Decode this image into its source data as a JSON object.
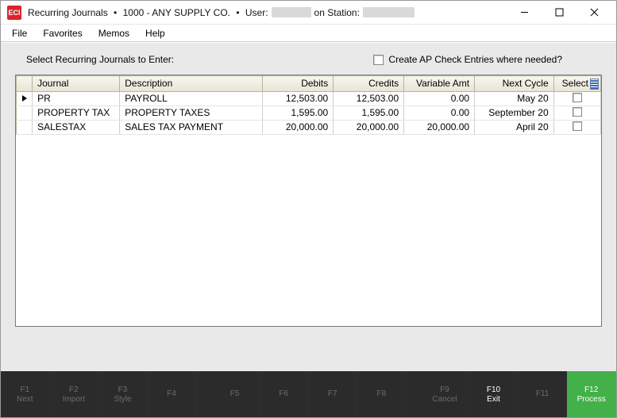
{
  "title": {
    "app_icon_text": "ECI",
    "window_name": "Recurring Journals",
    "company": "1000 - ANY SUPPLY CO.",
    "user_label": "User:",
    "station_label": "on Station:"
  },
  "menu": {
    "file": "File",
    "favorites": "Favorites",
    "memos": "Memos",
    "help": "Help"
  },
  "prompt": "Select Recurring Journals to Enter:",
  "ap_checkbox_label": "Create AP Check Entries where needed?",
  "columns": {
    "journal": "Journal",
    "description": "Description",
    "debits": "Debits",
    "credits": "Credits",
    "variable_amt": "Variable Amt",
    "next_cycle": "Next Cycle",
    "select": "Select"
  },
  "rows": [
    {
      "journal": "PR",
      "description": "PAYROLL",
      "debits": "12,503.00",
      "credits": "12,503.00",
      "variable_amt": "0.00",
      "next_cycle_prefix": "May 20",
      "current": true
    },
    {
      "journal": "PROPERTY TAX",
      "description": "PROPERTY TAXES",
      "debits": "1,595.00",
      "credits": "1,595.00",
      "variable_amt": "0.00",
      "next_cycle_prefix": "September 20",
      "current": false
    },
    {
      "journal": "SALESTAX",
      "description": "SALES TAX PAYMENT",
      "debits": "20,000.00",
      "credits": "20,000.00",
      "variable_amt": "20,000.00",
      "next_cycle_prefix": "April 20",
      "current": false
    }
  ],
  "footer": {
    "f1": {
      "key": "F1",
      "label": "Next"
    },
    "f2": {
      "key": "F2",
      "label": "Import"
    },
    "f3": {
      "key": "F3",
      "label": "Style"
    },
    "f4": {
      "key": "F4",
      "label": ""
    },
    "f5": {
      "key": "F5",
      "label": ""
    },
    "f6": {
      "key": "F6",
      "label": ""
    },
    "f7": {
      "key": "F7",
      "label": ""
    },
    "f8": {
      "key": "F8",
      "label": ""
    },
    "f9": {
      "key": "F9",
      "label": "Cancel"
    },
    "f10": {
      "key": "F10",
      "label": "Exit"
    },
    "f11": {
      "key": "F11",
      "label": ""
    },
    "f12": {
      "key": "F12",
      "label": "Process"
    }
  }
}
